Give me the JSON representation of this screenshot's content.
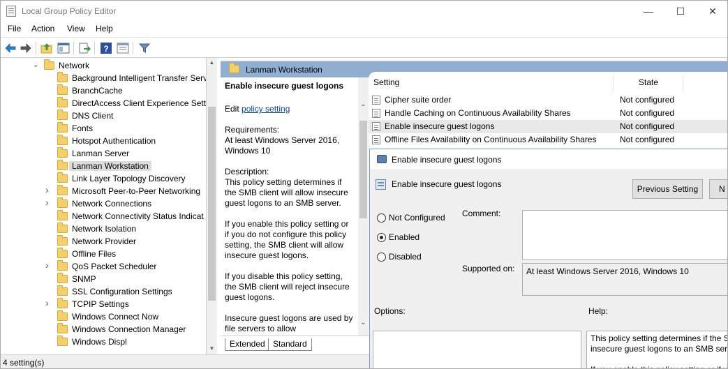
{
  "window": {
    "title": "Local Group Policy Editor",
    "minimize": "—",
    "maximize": "☐",
    "close": "✕"
  },
  "menu": [
    "File",
    "Action",
    "View",
    "Help"
  ],
  "toolbar": {
    "icons": [
      "back-icon",
      "forward-icon",
      "up-folder-icon",
      "show-hide-tree-icon",
      "export-list-icon",
      "help-icon",
      "properties-icon",
      "filter-icon"
    ]
  },
  "tree": {
    "parent": "Network",
    "items": [
      "Background Intelligent Transfer Serv",
      "BranchCache",
      "DirectAccess Client Experience Settir",
      "DNS Client",
      "Fonts",
      "Hotspot Authentication",
      "Lanman Server",
      "Lanman Workstation",
      "Link Layer Topology Discovery",
      "Microsoft Peer-to-Peer Networking",
      "Network Connections",
      "Network Connectivity Status Indicat",
      "Network Isolation",
      "Network Provider",
      "Offline Files",
      "QoS Packet Scheduler",
      "SNMP",
      "SSL Configuration Settings",
      "TCPIP Settings",
      "Windows Connect Now",
      "Windows Connection Manager",
      "Windows Displ"
    ],
    "expandable": [
      9,
      10,
      15,
      18
    ],
    "selected": 7
  },
  "pane": {
    "header": "Lanman Workstation"
  },
  "description": {
    "title": "Enable insecure guest logons",
    "edit_prefix": "Edit ",
    "edit_link": "policy setting ",
    "requirements": "Requirements:\nAt least Windows Server 2016, Windows 10",
    "description": "Description:\nThis policy setting determines if the SMB client will allow insecure guest logons to an SMB server.",
    "enable": "If you enable this policy setting or if you do not configure this policy setting, the SMB client will allow insecure guest logons.",
    "disable": "If you disable this policy setting, the SMB client will reject insecure guest logons.",
    "insecure": "Insecure guest logons are used by file servers to allow unauthenticated access to shared"
  },
  "tabs": [
    "Extended",
    "Standard"
  ],
  "list": {
    "columns": [
      "Setting",
      "State"
    ],
    "rows": [
      {
        "setting": "Cipher suite order",
        "state": "Not configured"
      },
      {
        "setting": "Handle Caching on Continuous Availability Shares",
        "state": "Not configured"
      },
      {
        "setting": "Enable insecure guest logons",
        "state": "Not configured"
      },
      {
        "setting": "Offline Files Availability on Continuous Availability Shares",
        "state": "Not configured"
      }
    ],
    "selected": 2
  },
  "dialog": {
    "title": "Enable insecure guest logons",
    "policy_name": "Enable insecure guest logons",
    "prev_button": "Previous Setting",
    "next_button": "N",
    "radio": {
      "not_configured": "Not Configured",
      "enabled": "Enabled",
      "disabled": "Disabled",
      "selected": "enabled"
    },
    "comment_label": "Comment:",
    "supported_label": "Supported on:",
    "supported_value": "At least Windows Server 2016, Windows 10",
    "options_label": "Options:",
    "help_label": "Help:",
    "help_text": "This policy setting determines if the S\ninsecure guest logons to an SMB serve\n\nIf you enable this policy setting or if y"
  },
  "status": {
    "text": "4 setting(s)"
  }
}
